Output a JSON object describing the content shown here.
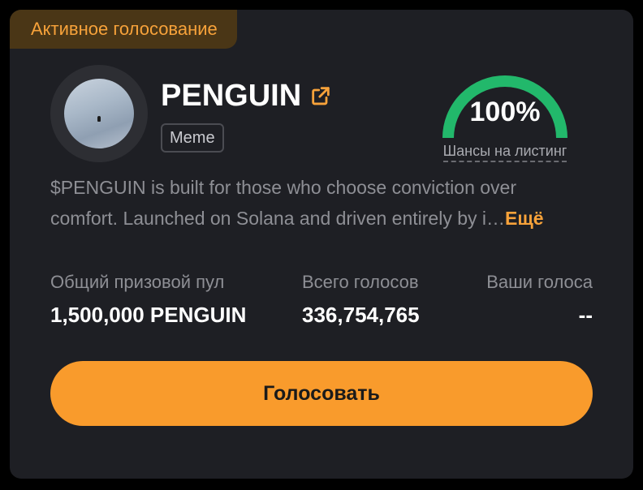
{
  "status": {
    "label": "Активное голосование"
  },
  "token": {
    "name": "PENGUIN",
    "category": "Meme"
  },
  "listing_chance": {
    "value": "100%",
    "fraction": 1.0,
    "label": "Шансы на листинг"
  },
  "description": {
    "line1": "$PENGUIN is built for those who choose conviction over",
    "line2": "comfort. Launched on Solana and driven entirely by i…",
    "more_label": "Ещё"
  },
  "stats": {
    "prize_pool": {
      "label": "Общий призовой пул",
      "value": "1,500,000 PENGUIN"
    },
    "total_votes": {
      "label": "Всего голосов",
      "value": "336,754,765"
    },
    "your_votes": {
      "label": "Ваши голоса",
      "value": "--"
    }
  },
  "vote_button": {
    "label": "Голосовать"
  },
  "colors": {
    "accent": "#f99b2c",
    "gauge": "#22b86b",
    "card_bg": "#1e1f24"
  },
  "icons": {
    "external_link": "external-link-icon"
  }
}
